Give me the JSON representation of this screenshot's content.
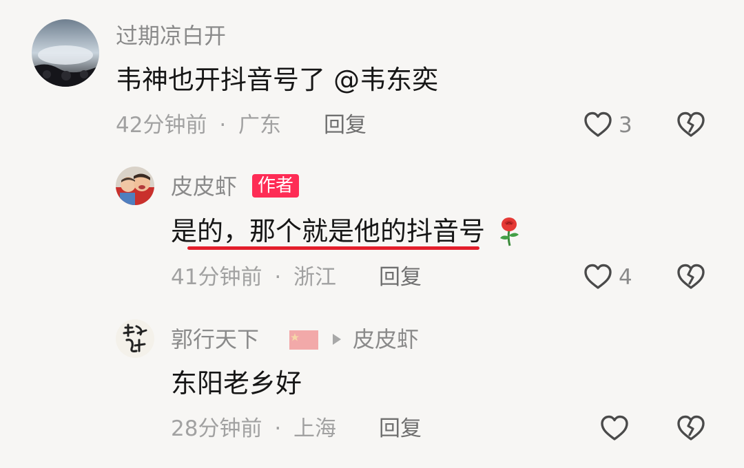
{
  "comments": [
    {
      "username": "过期凉白开",
      "text": "韦神也开抖音号了  @韦东奕",
      "time": "42分钟前",
      "location": "广东",
      "reply_label": "回复",
      "likes": "3",
      "avatar_icon": "concert-photo-avatar",
      "like_icon": "heart-outline-icon",
      "dislike_icon": "broken-heart-icon"
    },
    {
      "username": "皮皮虾",
      "badge": "作者",
      "text": "是的，那个就是他的抖音号",
      "emoji": "🌹",
      "time": "41分钟前",
      "location": "浙江",
      "reply_label": "回复",
      "likes": "4",
      "avatar_icon": "children-photo-avatar",
      "like_icon": "heart-outline-icon",
      "dislike_icon": "broken-heart-icon"
    },
    {
      "username": "郭行天下",
      "flag_icon": "china-flag-icon",
      "reply_to": "皮皮虾",
      "text": "东阳老乡好",
      "time": "28分钟前",
      "location": "上海",
      "reply_label": "回复",
      "likes": "",
      "avatar_icon": "calligraphy-avatar",
      "like_icon": "heart-outline-icon",
      "dislike_icon": "broken-heart-icon"
    }
  ],
  "separator": "·",
  "colors": {
    "badge": "#fe2c55",
    "highlight_underline": "#e31e2b",
    "background": "#f7f6f4"
  }
}
